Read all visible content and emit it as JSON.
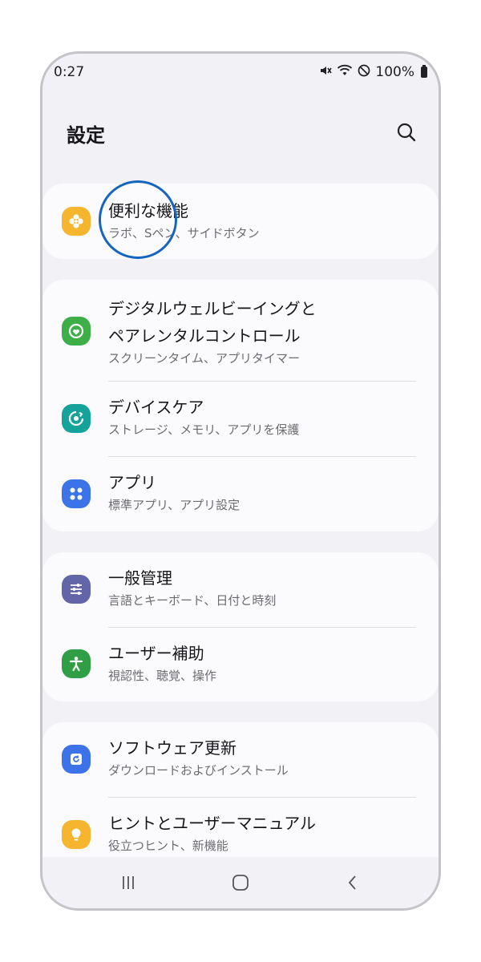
{
  "status_bar": {
    "time": "0:27",
    "battery": "100%"
  },
  "header": {
    "title": "設定"
  },
  "groups": [
    [
      {
        "title": "便利な機能",
        "subtitle": "ラボ、Sペン、サイドボタン",
        "icon": "gear-flower-icon",
        "color": "#f6b52e"
      }
    ],
    [
      {
        "title": "デジタルウェルビーイングと",
        "title2": "ペアレンタルコントロール",
        "subtitle": "スクリーンタイム、アプリタイマー",
        "icon": "wellbeing-icon",
        "color": "#3eae48"
      },
      {
        "title": "デバイスケア",
        "subtitle": "ストレージ、メモリ、アプリを保護",
        "icon": "device-care-icon",
        "color": "#14a39a"
      },
      {
        "title": "アプリ",
        "subtitle": "標準アプリ、アプリ設定",
        "icon": "apps-icon",
        "color": "#3d73e8"
      }
    ],
    [
      {
        "title": "一般管理",
        "subtitle": "言語とキーボード、日付と時刻",
        "icon": "sliders-icon",
        "color": "#6266a8"
      },
      {
        "title": "ユーザー補助",
        "subtitle": "視認性、聴覚、操作",
        "icon": "accessibility-icon",
        "color": "#2f9e45"
      }
    ],
    [
      {
        "title": "ソフトウェア更新",
        "subtitle": "ダウンロードおよびインストール",
        "icon": "software-update-icon",
        "color": "#3d73e8"
      },
      {
        "title": "ヒントとユーザーマニュアル",
        "subtitle": "役立つヒント、新機能",
        "icon": "lightbulb-icon",
        "color": "#f6b52e"
      }
    ]
  ],
  "colors": {
    "highlight": "#1565c0",
    "background": "#f2f2f6",
    "card": "#fbfbfd"
  }
}
